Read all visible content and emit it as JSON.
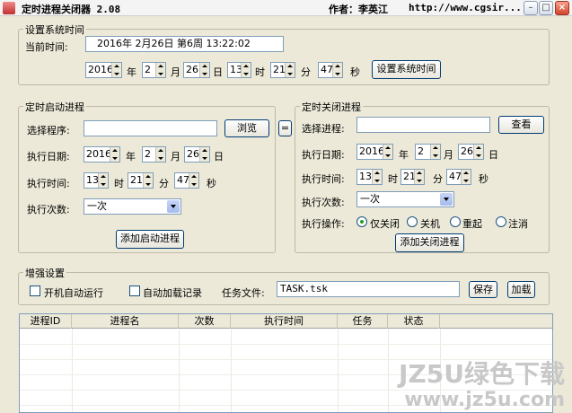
{
  "window": {
    "title": "定时进程关闭器 2.08",
    "author": "作者：李英江",
    "url": "http://www.cgsir...",
    "minimize": "–",
    "maximize": "□",
    "close": "×"
  },
  "system_time": {
    "group_label": "设置系统时间",
    "current_label": "当前时间:",
    "current_value": "2016年 2月26日 第6周 13:22:02",
    "year": "2016",
    "year_unit": "年",
    "month": "2",
    "month_unit": "月",
    "day": "26",
    "day_unit": "日",
    "hour": "13",
    "hour_unit": "时",
    "minute": "21",
    "minute_unit": "分",
    "second": "47",
    "second_unit": "秒",
    "set_button": "设置系统时间"
  },
  "start_process": {
    "group_label": "定时启动进程",
    "program_label": "选择程序:",
    "program_value": "",
    "browse_button": "浏览",
    "equals_button": "=",
    "date_label": "执行日期:",
    "year": "2016",
    "year_unit": "年",
    "month": "2",
    "month_unit": "月",
    "day": "26",
    "day_unit": "日",
    "time_label": "执行时间:",
    "hour": "13",
    "hour_unit": "时",
    "minute": "21",
    "minute_unit": "分",
    "second": "47",
    "second_unit": "秒",
    "times_label": "执行次数:",
    "times_value": "一次",
    "add_button": "添加启动进程"
  },
  "close_process": {
    "group_label": "定时关闭进程",
    "process_label": "选择进程:",
    "process_value": "",
    "view_button": "查看",
    "date_label": "执行日期:",
    "year": "2016",
    "year_unit": "年",
    "month": "2",
    "month_unit": "月",
    "day": "26",
    "day_unit": "日",
    "time_label": "执行时间:",
    "hour": "13",
    "hour_unit": "时",
    "minute": "21",
    "minute_unit": "分",
    "second": "47",
    "second_unit": "秒",
    "times_label": "执行次数:",
    "times_value": "一次",
    "action_label": "执行操作:",
    "actions": [
      "仅关闭",
      "关机",
      "重起",
      "注消"
    ],
    "selected_action": "仅关闭",
    "add_button": "添加关闭进程"
  },
  "enhanced": {
    "group_label": "增强设置",
    "autorun_label": "开机自动运行",
    "autoload_label": "自动加载记录",
    "task_file_label": "任务文件:",
    "task_file_value": "TASK.tsk",
    "save_button": "保存",
    "load_button": "加载"
  },
  "table": {
    "columns": [
      "进程ID",
      "进程名",
      "次数",
      "执行时间",
      "任务",
      "状态"
    ],
    "rows": []
  },
  "watermark": {
    "line1": "JZ5U绿色下载",
    "line2": "www.jz5u.com"
  }
}
